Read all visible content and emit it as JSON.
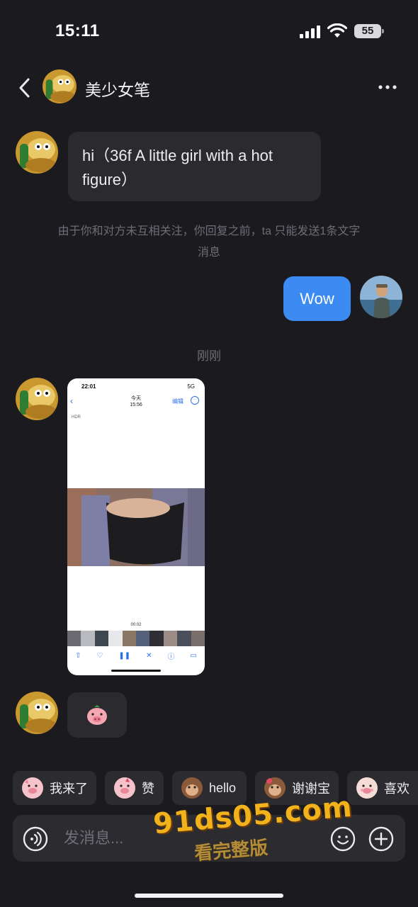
{
  "status_bar": {
    "time": "15:11",
    "battery": "55",
    "icons": [
      "signal-icon",
      "wifi-icon",
      "battery-icon"
    ]
  },
  "header": {
    "title": "美少女笔",
    "back_icon": "chevron-left-icon",
    "more_icon": "more-dots-icon"
  },
  "messages": {
    "incoming_text": {
      "line1": "hi（36f A little girl with a hot",
      "line2": "figure）"
    },
    "system_note": {
      "line1": "由于你和对方未互相关注，你回复之前，ta 只能发送1条文字",
      "line2": "消息"
    },
    "outgoing_text": "Wow",
    "timestamp": "刚刚",
    "media": {
      "phone_time": "22:01",
      "phone_network": "5G",
      "nav_title": "今天",
      "nav_subtitle": "15:56",
      "nav_edit": "编辑",
      "hdr_badge": "HDR",
      "duration": "00:02"
    },
    "sticker": "pig-face-sticker"
  },
  "quick_replies": [
    {
      "label": "我来了",
      "icon": "pig-emoji"
    },
    {
      "label": "赞",
      "icon": "pig-emoji"
    },
    {
      "label": "hello",
      "icon": "monkey-emoji"
    },
    {
      "label": "谢谢宝",
      "icon": "monkey-emoji"
    },
    {
      "label": "喜欢",
      "icon": "pig-emoji"
    }
  ],
  "input": {
    "placeholder": "发消息..."
  },
  "watermark": {
    "main": "91ds05.com",
    "sub": "看完整版"
  },
  "colors": {
    "background": "#1b1b1f",
    "bubble_in": "#2a2a2f",
    "bubble_out": "#3b8bf2",
    "muted_text": "#6d6d75"
  }
}
